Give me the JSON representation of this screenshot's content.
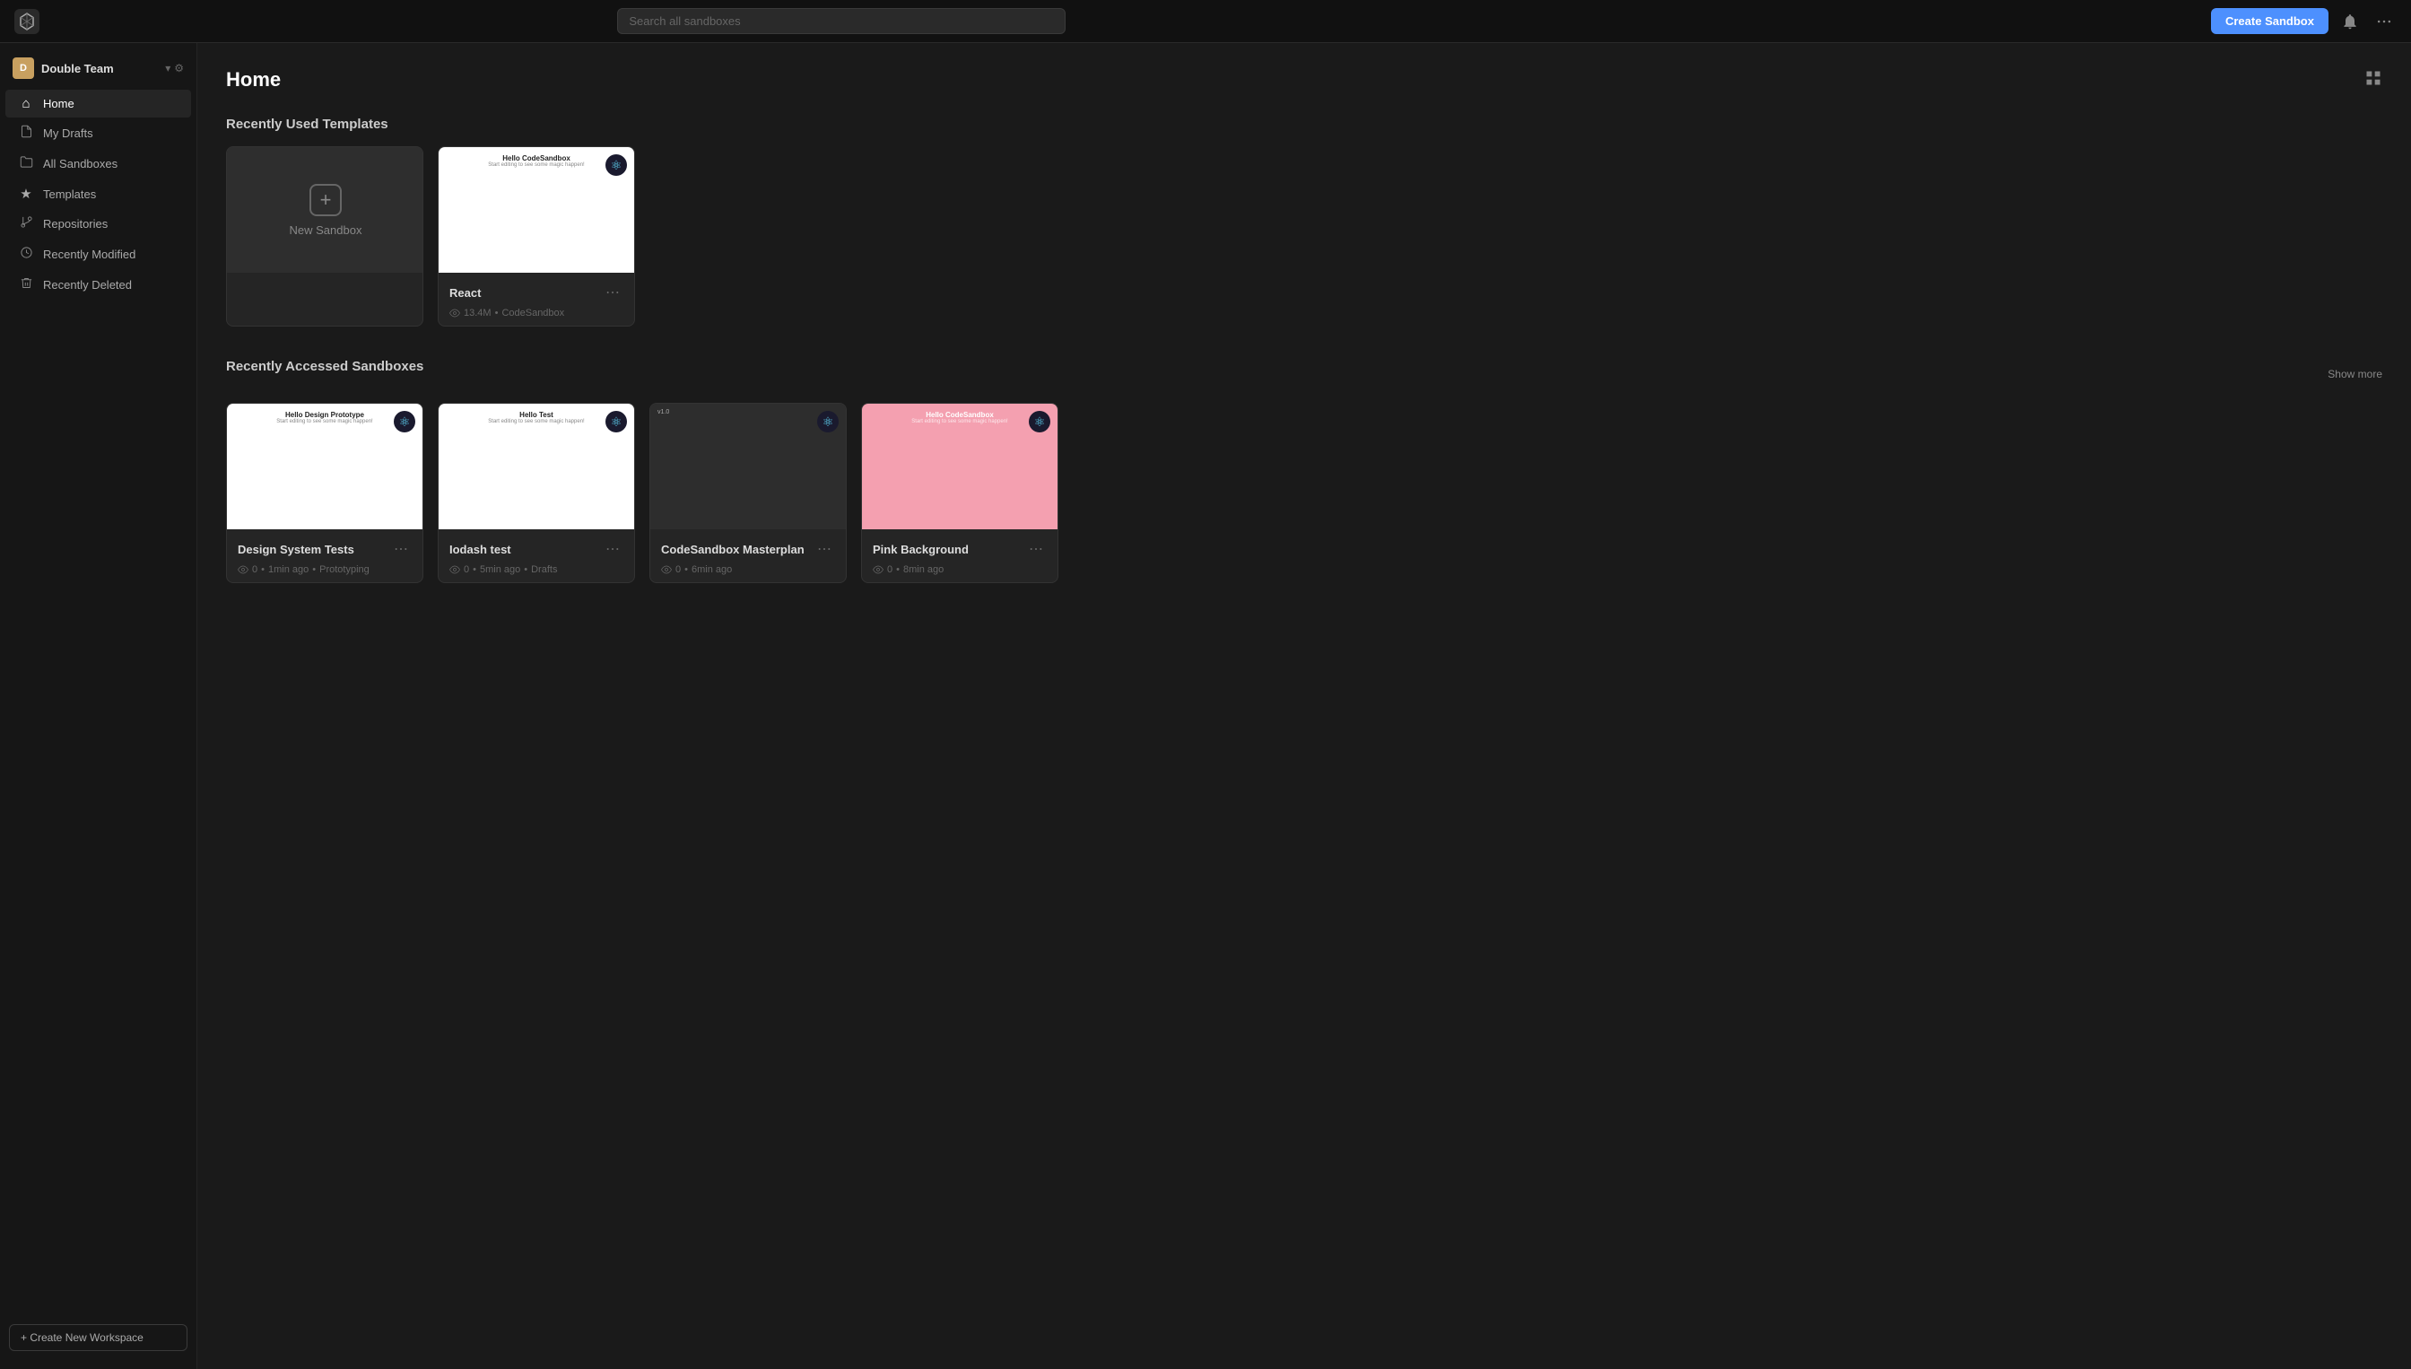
{
  "topbar": {
    "logo_label": "CodeSandbox",
    "search_placeholder": "Search all sandboxes",
    "create_sandbox_label": "Create Sandbox"
  },
  "sidebar": {
    "team_name": "Double Team",
    "team_avatar_initials": "D",
    "nav_items": [
      {
        "id": "home",
        "label": "Home",
        "icon": "⌂",
        "active": true
      },
      {
        "id": "my-drafts",
        "label": "My Drafts",
        "icon": "📄",
        "active": false
      },
      {
        "id": "all-sandboxes",
        "label": "All Sandboxes",
        "icon": "📁",
        "active": false
      },
      {
        "id": "templates",
        "label": "Templates",
        "icon": "★",
        "active": false
      },
      {
        "id": "repositories",
        "label": "Repositories",
        "icon": "⑂",
        "active": false
      },
      {
        "id": "recently-modified",
        "label": "Recently Modified",
        "icon": "🕐",
        "active": false
      },
      {
        "id": "recently-deleted",
        "label": "Recently Deleted",
        "icon": "🗑",
        "active": false
      }
    ],
    "create_workspace_label": "+ Create New Workspace"
  },
  "main": {
    "page_title": "Home",
    "recently_used_templates_title": "Recently Used Templates",
    "recently_accessed_title": "Recently Accessed Sandboxes",
    "show_more_label": "Show more",
    "new_sandbox_label": "New Sandbox",
    "templates": [
      {
        "id": "react",
        "name": "React",
        "preview_type": "react",
        "preview_title": "Hello CodeSandbox",
        "preview_sub": "Start editing to see some magic happen!",
        "views": "13.4M",
        "author": "CodeSandbox",
        "icon": "⚛"
      }
    ],
    "sandboxes": [
      {
        "id": "design-system-tests",
        "name": "Design System Tests",
        "preview_type": "white",
        "preview_title": "Hello Design Prototype",
        "preview_sub": "Start editing to see some magic happen!",
        "views": "0",
        "time": "1min ago",
        "tag": "Prototyping",
        "icon": "⚛"
      },
      {
        "id": "lodash-test",
        "name": "Iodash test",
        "preview_type": "white",
        "preview_title": "Hello Test",
        "preview_sub": "Start editing to see some magic happen!",
        "views": "0",
        "time": "5min ago",
        "tag": "Drafts",
        "icon": "⚛"
      },
      {
        "id": "codesandbox-masterplan",
        "name": "CodeSandbox Masterplan",
        "preview_type": "dark",
        "preview_title": "v1.0",
        "preview_sub": "",
        "views": "0",
        "time": "6min ago",
        "tag": "",
        "icon": "⚛"
      },
      {
        "id": "pink-background",
        "name": "Pink Background",
        "preview_type": "pink",
        "preview_title": "Hello CodeSandbox",
        "preview_sub": "Start editing to see some magic happen!",
        "views": "0",
        "time": "8min ago",
        "tag": "",
        "icon": "⚛"
      }
    ]
  }
}
